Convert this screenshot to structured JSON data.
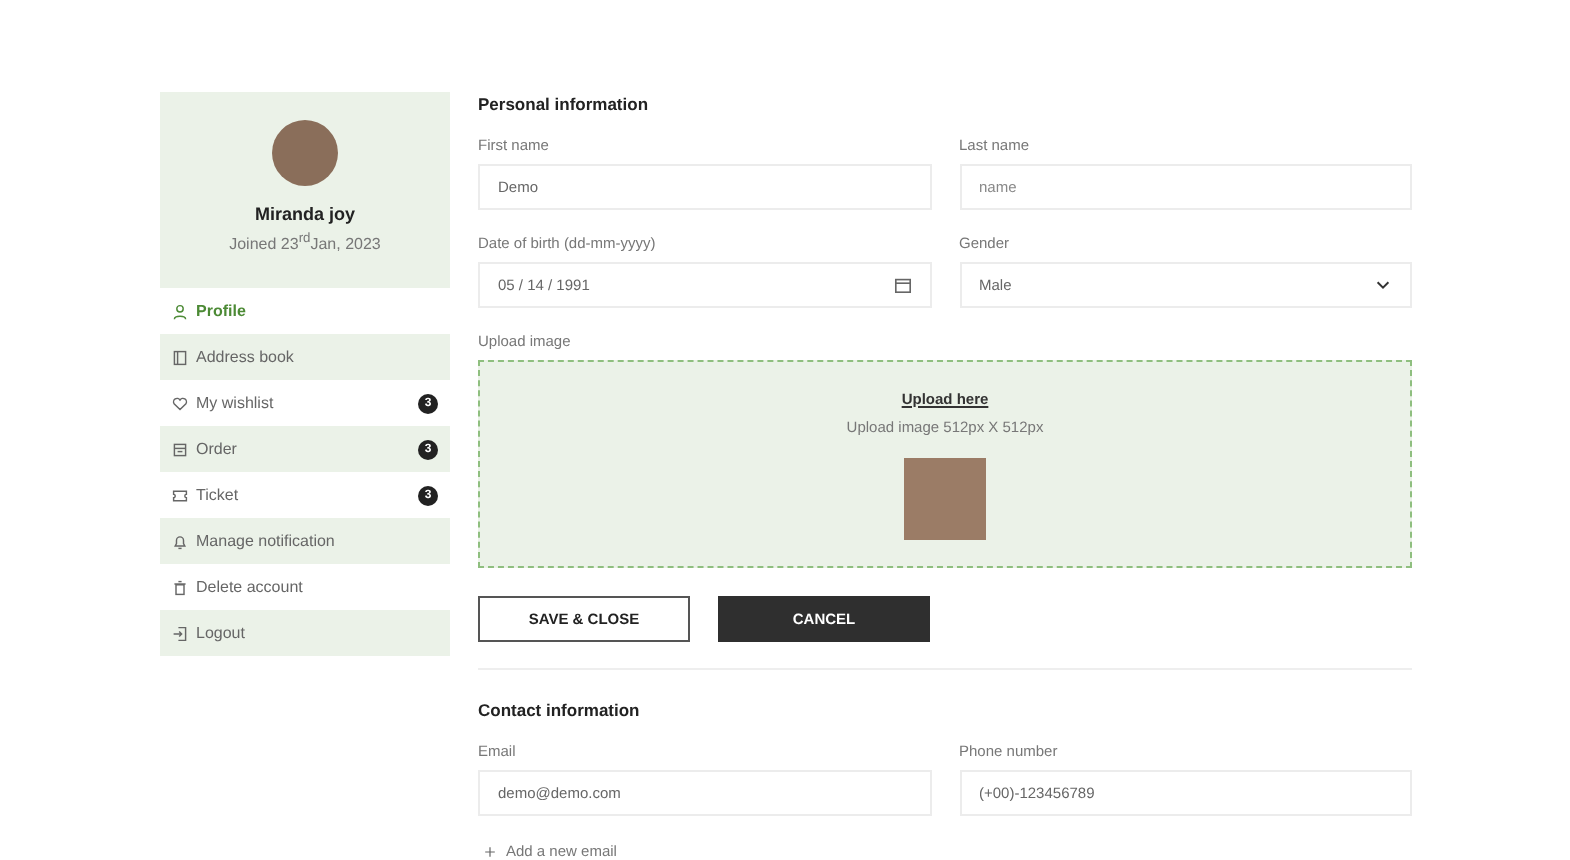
{
  "profile": {
    "name": "Miranda joy",
    "joined": "Joined 23$^{rd}$Jan, 2023"
  },
  "menu": [
    {
      "label": "Profile",
      "selected": true
    },
    {
      "label": "Address book",
      "selected": false
    },
    {
      "label": "My wishlist",
      "selected": false,
      "badge": "3"
    },
    {
      "label": "Order",
      "selected": false,
      "badge": "3"
    },
    {
      "label": "Ticket",
      "selected": false,
      "badge": "3"
    },
    {
      "label": "Manage notification",
      "selected": false
    },
    {
      "label": "Delete account",
      "selected": false
    },
    {
      "label": "Logout",
      "selected": false
    }
  ],
  "personal": {
    "title": "Personal information",
    "fields": [
      {
        "label": "First name",
        "value": "Demo",
        "kind": "text"
      },
      {
        "label": "Last name",
        "placeholder": "name",
        "kind": "text"
      },
      {
        "label": "Date of birth (dd-mm-yyyy)",
        "value": "05 / 14 / 1991",
        "kind": "date"
      },
      {
        "label": "Gender",
        "value": "Male",
        "kind": "select"
      }
    ],
    "upload": {
      "label": "Upload image",
      "link": "Upload here",
      "hint": "Upload image 512px X 512px"
    },
    "buttons": [
      {
        "label": "SAVE & CLOSE",
        "kind": "outline"
      },
      {
        "label": "CANCEL",
        "kind": "dark"
      }
    ]
  },
  "contact": {
    "title": "Contact information",
    "fields": [
      {
        "label": "Email",
        "value": "demo@demo.com",
        "kind": "text"
      },
      {
        "label": "Phone number",
        "value": "(+00)-123456789",
        "kind": "text"
      }
    ],
    "add": "Add a new email"
  }
}
